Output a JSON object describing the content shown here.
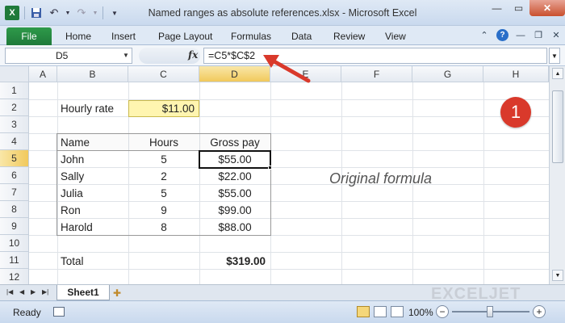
{
  "window": {
    "title": "Named ranges as absolute references.xlsx - Microsoft Excel",
    "app_logo": "X"
  },
  "ribbon": {
    "tabs": [
      {
        "label": "File"
      },
      {
        "label": "Home"
      },
      {
        "label": "Insert"
      },
      {
        "label": "Page Layout"
      },
      {
        "label": "Formulas"
      },
      {
        "label": "Data"
      },
      {
        "label": "Review"
      },
      {
        "label": "View"
      }
    ]
  },
  "formula_bar": {
    "name_box": "D5",
    "fx": "fx",
    "formula": "=C5*$C$2"
  },
  "columns": [
    "A",
    "B",
    "C",
    "D",
    "E",
    "F",
    "G",
    "H"
  ],
  "rows": [
    "1",
    "2",
    "3",
    "4",
    "5",
    "6",
    "7",
    "8",
    "9",
    "10",
    "11",
    "12"
  ],
  "sheet": {
    "rate_label": "Hourly rate",
    "rate_value": "$11.00",
    "headers": {
      "name": "Name",
      "hours": "Hours",
      "gross": "Gross pay"
    },
    "records": [
      {
        "name": "John",
        "hours": "5",
        "gross": "$55.00"
      },
      {
        "name": "Sally",
        "hours": "2",
        "gross": "$22.00"
      },
      {
        "name": "Julia",
        "hours": "5",
        "gross": "$55.00"
      },
      {
        "name": "Ron",
        "hours": "9",
        "gross": "$99.00"
      },
      {
        "name": "Harold",
        "hours": "8",
        "gross": "$88.00"
      }
    ],
    "total_label": "Total",
    "total_value": "$319.00",
    "note": "Original formula",
    "badge": "1"
  },
  "sheet_tabs": [
    {
      "label": "Sheet1"
    }
  ],
  "watermark": "EXCELJET",
  "status": {
    "ready": "Ready",
    "zoom": "100%",
    "zoom_minus": "−",
    "zoom_plus": "+"
  },
  "colors": {
    "file_tab": "#1f7a3a",
    "selected_header": "#f1c95c",
    "rate_fill": "#fff5b0",
    "badge": "#d9392b",
    "arrow": "#d9392b"
  }
}
